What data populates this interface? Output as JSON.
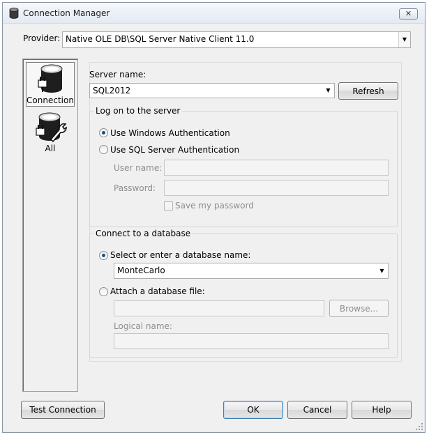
{
  "window": {
    "title": "Connection Manager",
    "close_glyph": "✕"
  },
  "provider": {
    "label": "Provider:",
    "value": "Native OLE DB\\SQL Server Native Client 11.0"
  },
  "sidebar": {
    "items": [
      {
        "label": "Connection",
        "icon": "database-plug-icon"
      },
      {
        "label": "All",
        "icon": "database-wrench-icon"
      }
    ]
  },
  "server": {
    "label": "Server name:",
    "value": "SQL2012",
    "refresh_label": "Refresh"
  },
  "logon": {
    "title": "Log on to the server",
    "windows_auth": "Use Windows Authentication",
    "sql_auth": "Use SQL Server Authentication",
    "username_label": "User name:",
    "password_label": "Password:",
    "save_password": "Save my password"
  },
  "database": {
    "title": "Connect to a database",
    "select_label": "Select or enter a database name:",
    "selected_db": "MonteCarlo",
    "attach_label": "Attach a database file:",
    "browse_label": "Browse...",
    "logical_label": "Logical name:"
  },
  "footer": {
    "test_label": "Test Connection",
    "ok_label": "OK",
    "cancel_label": "Cancel",
    "help_label": "Help"
  },
  "glyphs": {
    "dropdown_arrow": "▼"
  }
}
